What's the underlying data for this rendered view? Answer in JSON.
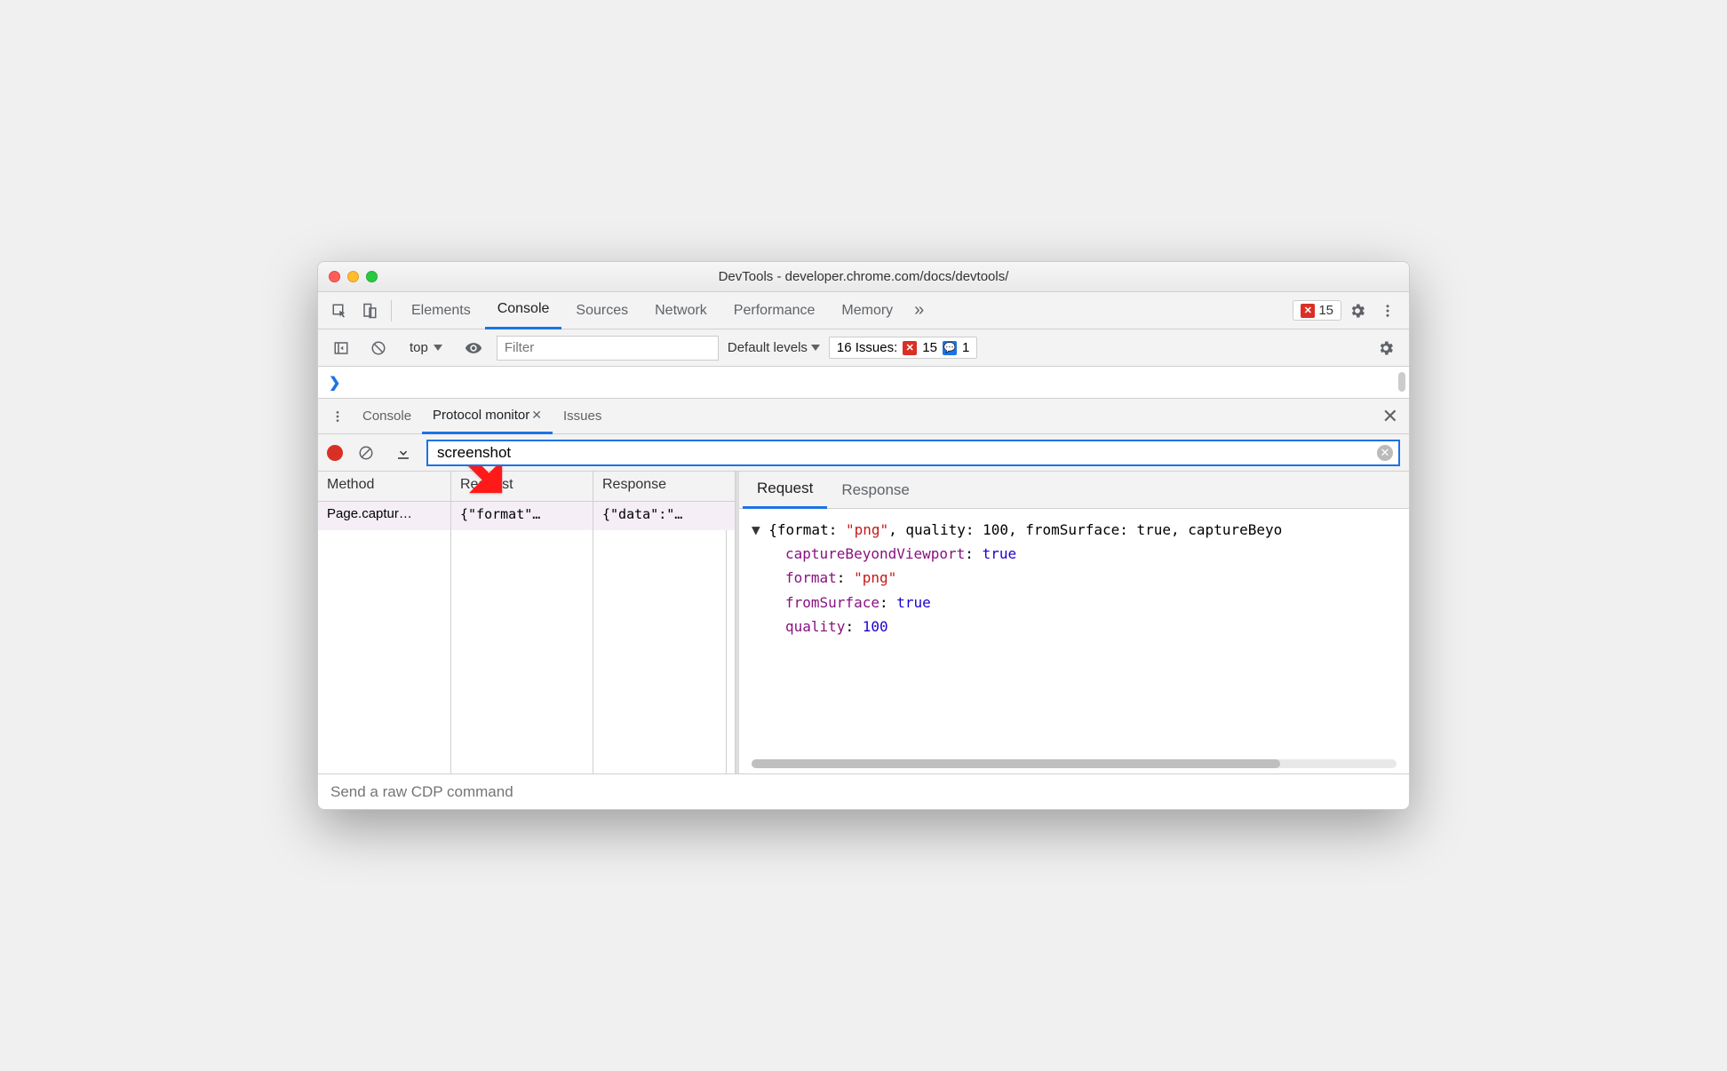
{
  "window": {
    "title": "DevTools - developer.chrome.com/docs/devtools/"
  },
  "mainTabs": {
    "items": [
      "Elements",
      "Console",
      "Sources",
      "Network",
      "Performance",
      "Memory"
    ],
    "activeIndex": 1,
    "overflowGlyph": "»"
  },
  "errorBadge": {
    "count": "15"
  },
  "consoleBar": {
    "context": "top",
    "filterPlaceholder": "Filter",
    "levelsLabel": "Default levels",
    "issues": {
      "label": "16 Issues:",
      "errors": "15",
      "messages": "1"
    }
  },
  "promptGlyph": "❯",
  "drawer": {
    "tabs": [
      {
        "label": "Console",
        "closable": false
      },
      {
        "label": "Protocol monitor",
        "closable": true
      },
      {
        "label": "Issues",
        "closable": false
      }
    ],
    "activeIndex": 1
  },
  "protocolMonitor": {
    "filterValue": "screenshot",
    "columns": [
      "Method",
      "Request",
      "Response"
    ],
    "rows": [
      {
        "method": "Page.captur…",
        "request": "{\"format\"…",
        "response": "{\"data\":\"…"
      }
    ],
    "detailTabs": [
      "Request",
      "Response"
    ],
    "detailActiveIndex": 0,
    "detail": {
      "summaryPrefix": "{format: ",
      "summaryRest": ", quality: 100, fromSurface: true, captureBeyo",
      "formatValue": "\"png\"",
      "props": [
        {
          "key": "captureBeyondViewport",
          "value": "true",
          "type": "b"
        },
        {
          "key": "format",
          "value": "\"png\"",
          "type": "s"
        },
        {
          "key": "fromSurface",
          "value": "true",
          "type": "b"
        },
        {
          "key": "quality",
          "value": "100",
          "type": "n"
        }
      ]
    },
    "cdpPlaceholder": "Send a raw CDP command"
  }
}
